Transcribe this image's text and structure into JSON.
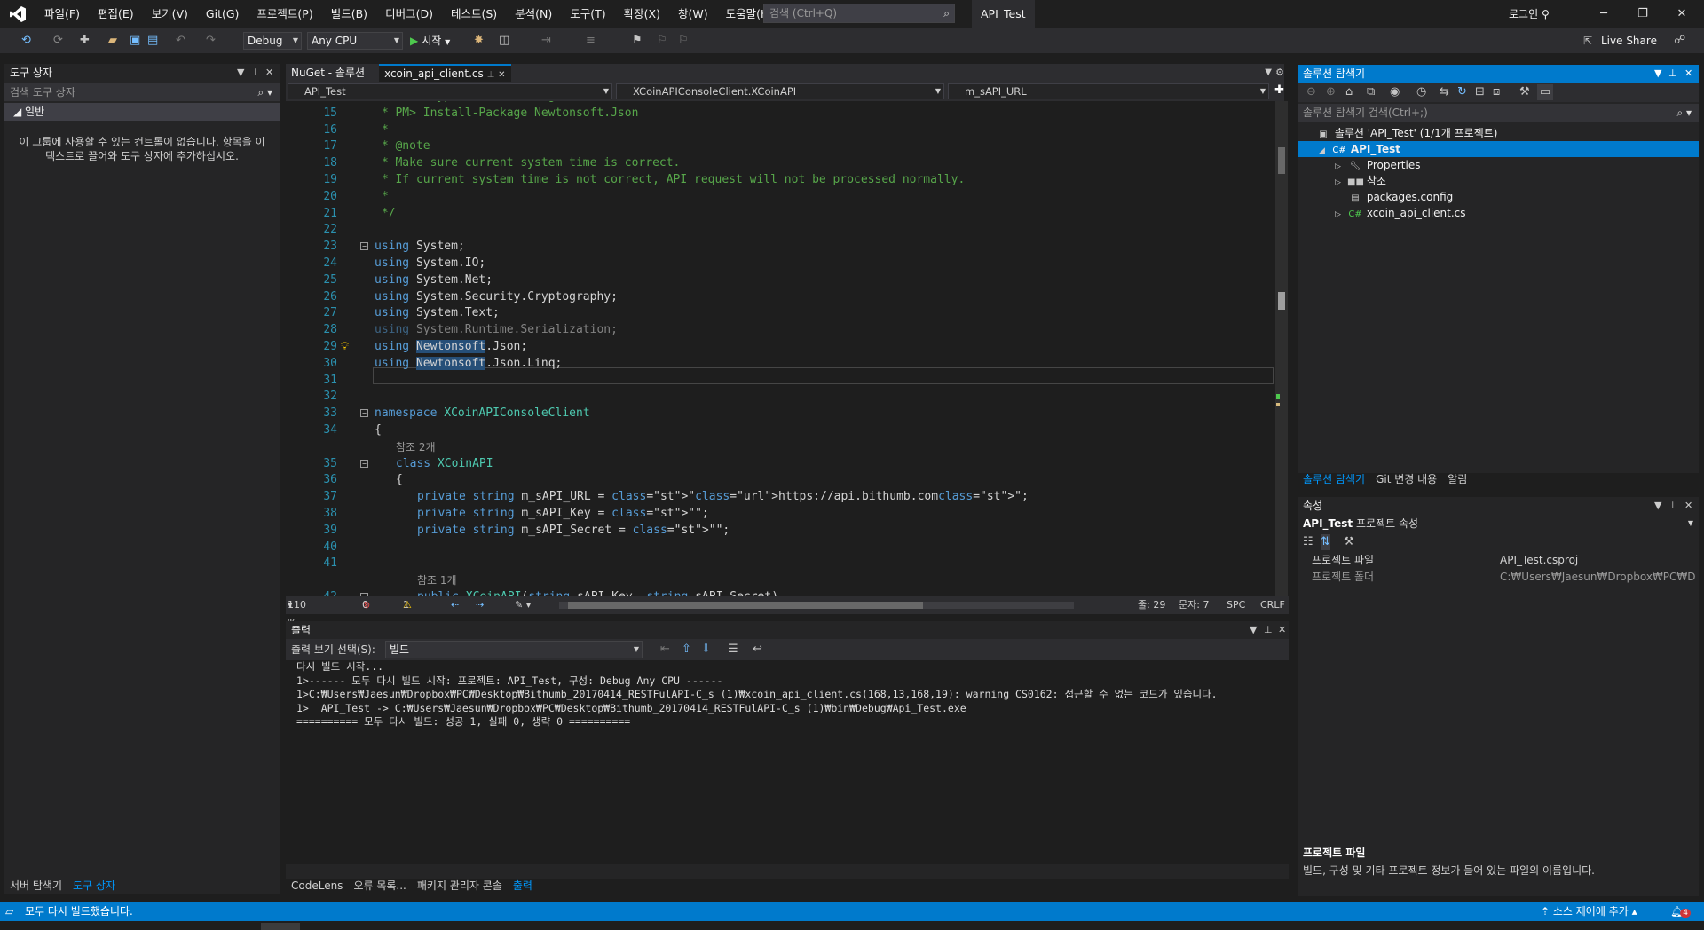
{
  "titlebar": {
    "menus": [
      "파일(F)",
      "편집(E)",
      "보기(V)",
      "Git(G)",
      "프로젝트(P)",
      "빌드(B)",
      "디버그(D)",
      "테스트(S)",
      "분석(N)",
      "도구(T)",
      "확장(X)",
      "창(W)",
      "도움말(H)"
    ],
    "search_placeholder": "검색 (Ctrl+Q)",
    "solution_name": "API_Test",
    "login": "로그인"
  },
  "toolbar": {
    "config": "Debug",
    "platform": "Any CPU",
    "run_label": "시작",
    "live_share": "Live Share"
  },
  "toolbox": {
    "title": "도구 상자",
    "search_placeholder": "검색 도구 상자",
    "group": "일반",
    "empty_message": "이 그룹에 사용할 수 있는 컨트롤이 없습니다. 항목을 이 텍스트로 끌어와 도구 상자에 추가하십시오.",
    "tabs": [
      "서버 탐색기",
      "도구 상자"
    ]
  },
  "editor": {
    "tabs": [
      "NuGet - 솔루션",
      "xcoin_api_client.cs"
    ],
    "nav": [
      "API_Test",
      "XCoinAPIConsoleClient.XCoinAPI",
      "m_sAPI_URL"
    ],
    "status": {
      "zoom": "110 %",
      "errors": "0",
      "warnings": "1",
      "line": "줄: 29",
      "col": "문자: 7",
      "spc": "SPC",
      "crlf": "CRLF"
    }
  },
  "code_lines": [
    {
      "n": "14",
      "t": " * Then type the following:"
    },
    {
      "n": "15",
      "t": " * PM> Install-Package Newtonsoft.Json"
    },
    {
      "n": "16",
      "t": " *"
    },
    {
      "n": "17",
      "t": " * @note"
    },
    {
      "n": "18",
      "t": " * Make sure current system time is correct."
    },
    {
      "n": "19",
      "t": " * If current system time is not correct, API request will not be processed normally."
    },
    {
      "n": "20",
      "t": " *"
    },
    {
      "n": "21",
      "t": " */"
    },
    {
      "n": "22",
      "t": ""
    },
    {
      "n": "23",
      "t": "using System;"
    },
    {
      "n": "24",
      "t": "using System.IO;"
    },
    {
      "n": "25",
      "t": "using System.Net;"
    },
    {
      "n": "26",
      "t": "using System.Security.Cryptography;"
    },
    {
      "n": "27",
      "t": "using System.Text;"
    },
    {
      "n": "28",
      "t": "using System.Runtime.Serialization;"
    },
    {
      "n": "29",
      "t": "using Newtonsoft.Json;"
    },
    {
      "n": "30",
      "t": "using Newtonsoft.Json.Linq;"
    },
    {
      "n": "31",
      "t": ""
    },
    {
      "n": "32",
      "t": ""
    },
    {
      "n": "33",
      "t": "namespace XCoinAPIConsoleClient"
    },
    {
      "n": "34",
      "t": "{"
    },
    {
      "n": "",
      "t": "참조 2개"
    },
    {
      "n": "35",
      "t": "class XCoinAPI"
    },
    {
      "n": "36",
      "t": "{"
    },
    {
      "n": "37",
      "t": "private string m_sAPI_URL = \"https://api.bithumb.com\";"
    },
    {
      "n": "38",
      "t": "private string m_sAPI_Key = \"\";"
    },
    {
      "n": "39",
      "t": "private string m_sAPI_Secret = \"\";"
    },
    {
      "n": "40",
      "t": ""
    },
    {
      "n": "41",
      "t": ""
    },
    {
      "n": "",
      "t": "참조 1개"
    },
    {
      "n": "42",
      "t": "public XCoinAPI(string sAPI_Key, string sAPI_Secret)"
    }
  ],
  "output": {
    "title": "출력",
    "source_label": "출력 보기 선택(S):",
    "source": "빌드",
    "lines": [
      "다시 빌드 시작...",
      "1>------ 모두 다시 빌드 시작: 프로젝트: API_Test, 구성: Debug Any CPU ------",
      "1>C:₩Users₩Jaesun₩Dropbox₩PC₩Desktop₩Bithumb_20170414_RESTFulAPI-C_s (1)₩xcoin_api_client.cs(168,13,168,19): warning CS0162: 접근할 수 없는 코드가 있습니다.",
      "1>  API_Test -> C:₩Users₩Jaesun₩Dropbox₩PC₩Desktop₩Bithumb_20170414_RESTFulAPI-C_s (1)₩bin₩Debug₩Api_Test.exe",
      "========== 모두 다시 빌드: 성공 1, 실패 0, 생략 0 =========="
    ],
    "tabs": [
      "CodeLens",
      "오류 목록...",
      "패키지 관리자 콘솔",
      "출력"
    ]
  },
  "solution_explorer": {
    "title": "솔루션 탐색기",
    "search_placeholder": "솔루션 탐색기 검색(Ctrl+;)",
    "items": [
      {
        "label": "솔루션 'API_Test' (1/1개 프로젝트)",
        "depth": 0
      },
      {
        "label": "API_Test",
        "depth": 1
      },
      {
        "label": "Properties",
        "depth": 2
      },
      {
        "label": "참조",
        "depth": 2
      },
      {
        "label": "packages.config",
        "depth": 2
      },
      {
        "label": "xcoin_api_client.cs",
        "depth": 2
      }
    ],
    "tabs": [
      "솔루션 탐색기",
      "Git 변경 내용",
      "알림"
    ]
  },
  "properties": {
    "title": "속성",
    "object_name": "API_Test",
    "object_type": "프로젝트 속성",
    "rows": [
      {
        "key": "프로젝트 파일",
        "value": "API_Test.csproj"
      },
      {
        "key": "프로젝트 폴더",
        "value": "C:₩Users₩Jaesun₩Dropbox₩PC₩Desktop₩"
      }
    ],
    "desc_title": "프로젝트 파일",
    "desc_text": "빌드, 구성 및 기타 프로젝트 정보가 들어 있는 파일의 이름입니다."
  },
  "statusbar": {
    "message": "모두 다시 빌드했습니다.",
    "source_control": "소스 제어에 추가",
    "notifications": "4"
  },
  "colors": {
    "accent": "#007acc",
    "background": "#1e1e1e",
    "panel": "#252526"
  }
}
